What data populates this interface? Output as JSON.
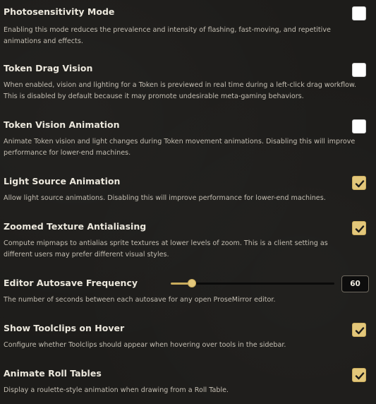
{
  "colors": {
    "accent": "#e3c77a",
    "background": "#1d1c1a",
    "label": "#ebe7dc",
    "hint": "#c4beb2"
  },
  "settings": [
    {
      "label": "Photosensitivity Mode",
      "hint": "Enabling this mode reduces the prevalence and intensity of flashing, fast-moving, and repetitive animations and effects.",
      "control": "checkbox",
      "checked": false
    },
    {
      "label": "Token Drag Vision",
      "hint": "When enabled, vision and lighting for a Token is previewed in real time during a left-click drag workflow. This is disabled by default because it may promote undesirable meta-gaming behaviors.",
      "control": "checkbox",
      "checked": false
    },
    {
      "label": "Token Vision Animation",
      "hint": "Animate Token vision and light changes during Token movement animations. Disabling this will improve performance for lower-end machines.",
      "control": "checkbox",
      "checked": false
    },
    {
      "label": "Light Source Animation",
      "hint": "Allow light source animations. Disabling this will improve performance for lower-end machines.",
      "control": "checkbox",
      "checked": true
    },
    {
      "label": "Zoomed Texture Antialiasing",
      "hint": "Compute mipmaps to antialias sprite textures at lower levels of zoom. This is a client setting as different users may prefer different visual styles.",
      "control": "checkbox",
      "checked": true
    },
    {
      "label": "Editor Autosave Frequency",
      "hint": "The number of seconds between each autosave for any open ProseMirror editor.",
      "control": "slider",
      "value": "60",
      "fraction": 0.13
    },
    {
      "label": "Show Toolclips on Hover",
      "hint": "Configure whether Toolclips should appear when hovering over tools in the sidebar.",
      "control": "checkbox",
      "checked": true
    },
    {
      "label": "Animate Roll Tables",
      "hint": "Display a roulette-style animation when drawing from a Roll Table.",
      "control": "checkbox",
      "checked": true
    }
  ]
}
